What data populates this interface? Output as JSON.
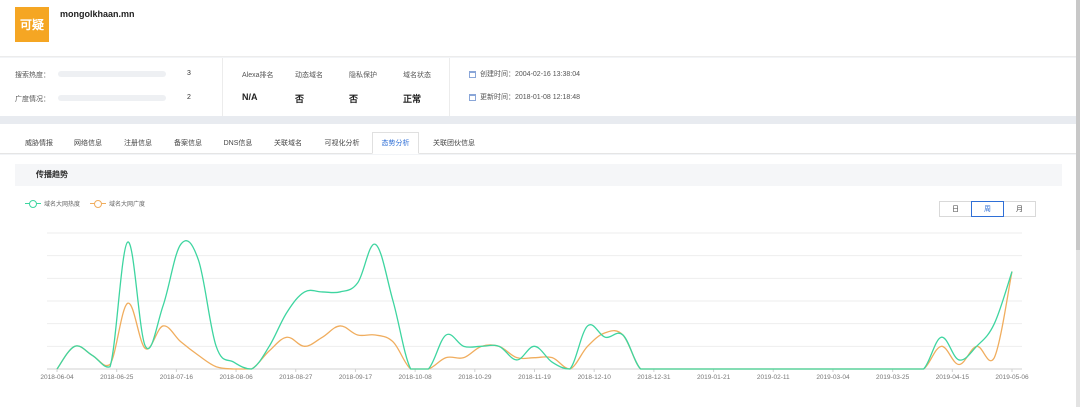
{
  "header": {
    "badge": "可疑",
    "domain": "mongolkhaan.mn"
  },
  "stats": [
    {
      "label": "搜索热度：",
      "value": "3"
    },
    {
      "label": "广度情况：",
      "value": "2"
    }
  ],
  "columns": [
    {
      "head": "Alexa排名",
      "value": "N/A"
    },
    {
      "head": "动态域名",
      "value": "否"
    },
    {
      "head": "隐私保护",
      "value": "否"
    },
    {
      "head": "域名状态",
      "value": "正常"
    }
  ],
  "times": {
    "created": "创建时间：2004-02-16 13:38:04",
    "updated": "更新时间：2018-01-08 12:18:48"
  },
  "tabs": [
    "威胁情报",
    "网络信息",
    "注册信息",
    "备案信息",
    "DNS信息",
    "关联域名",
    "可视化分析",
    "态势分析",
    "关联团伙信息"
  ],
  "active_tab": "态势分析",
  "section_title": "传播趋势",
  "range_buttons": [
    "日",
    "周",
    "月"
  ],
  "active_range": "周",
  "colors": {
    "heat": "#3ed5a0",
    "breadth": "#f0ad5e",
    "accent": "#2f6fd6",
    "badge": "#f5a623"
  },
  "chart_data": {
    "type": "line",
    "x_tick_labels": [
      "2018-06-04",
      "2018-06-25",
      "2018-07-16",
      "2018-08-06",
      "2018-08-27",
      "2018-09-17",
      "2018-10-08",
      "2018-10-29",
      "2018-11-19",
      "2018-12-10",
      "2018-12-31",
      "2019-01-21",
      "2019-02-11",
      "2019-03-04",
      "2019-03-25",
      "2019-04-15",
      "2019-05-06"
    ],
    "y_axis_labels": "not shown",
    "grid": "horizontal",
    "legend_position": "top-left",
    "series": [
      {
        "name": "域名大网热度",
        "color": "#3ed5a0",
        "values": [
          0,
          1.0,
          0.6,
          0.1,
          5.6,
          1.0,
          2.8,
          5.5,
          4.8,
          1.0,
          0.3,
          0,
          1.0,
          2.5,
          3.4,
          3.4,
          3.4,
          3.8,
          5.5,
          3.0,
          0,
          0,
          1.5,
          1.0,
          1.0,
          1.0,
          0.4,
          1.0,
          0.3,
          0,
          1.9,
          1.4,
          1.5,
          0,
          0,
          0,
          0,
          0,
          0,
          0,
          0,
          0,
          0,
          0,
          0,
          0,
          0,
          0,
          0,
          0,
          1.4,
          0.4,
          1.0,
          2.0,
          4.3
        ]
      },
      {
        "name": "域名大网广度",
        "color": "#f0ad5e",
        "values": [
          0,
          1.0,
          0.6,
          0.2,
          2.9,
          0.9,
          1.9,
          1.2,
          0.6,
          0.1,
          0,
          0,
          0.8,
          1.4,
          1.0,
          1.4,
          1.9,
          1.5,
          1.5,
          1.2,
          0,
          0,
          0.5,
          0.5,
          1.0,
          1.0,
          0.5,
          0.5,
          0.5,
          0,
          1.0,
          1.6,
          1.5,
          0,
          0,
          0,
          0,
          0,
          0,
          0,
          0,
          0,
          0,
          0,
          0,
          0,
          0,
          0,
          0,
          0,
          1.0,
          0.2,
          1.0,
          0.5,
          4.3
        ]
      }
    ]
  }
}
